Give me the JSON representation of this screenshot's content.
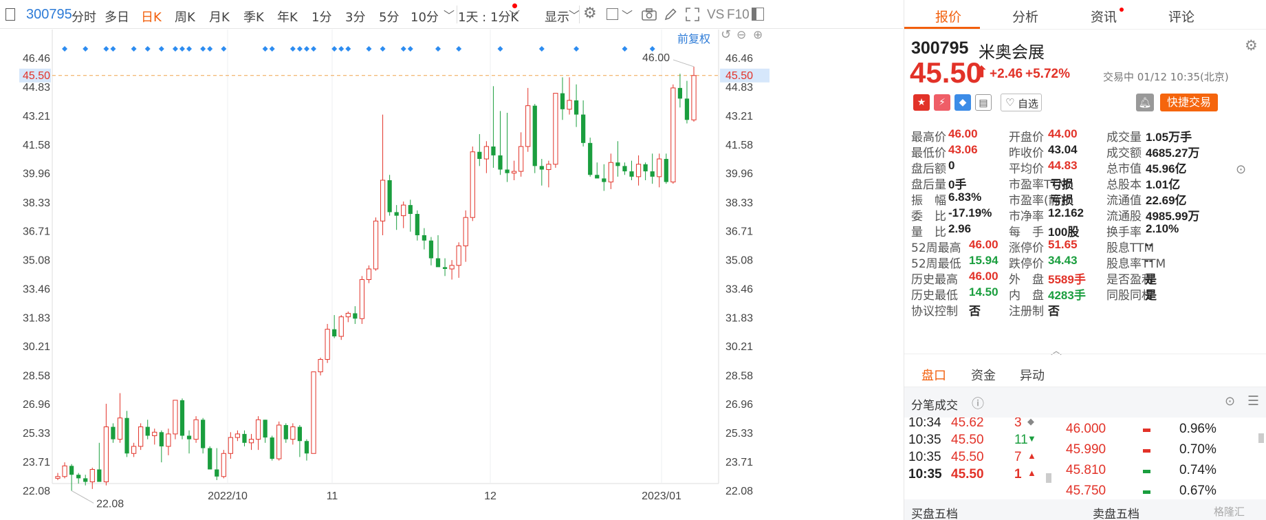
{
  "toolbar": {
    "code": "300795",
    "tabs": [
      "分时",
      "多日",
      "日K",
      "周K",
      "月K",
      "季K",
      "年K",
      "1分",
      "3分",
      "5分",
      "10分"
    ],
    "active_tab": "日K",
    "interval_label": "1天 : 1分K",
    "display_label": "显示",
    "vs_label": "VS",
    "f10_label": "F10",
    "fq_label": "前复权"
  },
  "chart_data": {
    "type": "candlestick",
    "x_ticks": [
      "2022/10",
      "11",
      "12",
      "2023/01"
    ],
    "y_ticks": [
      46.46,
      44.83,
      43.21,
      41.58,
      39.96,
      38.33,
      36.71,
      35.08,
      33.46,
      31.83,
      30.21,
      28.58,
      26.96,
      25.33,
      23.71,
      22.08
    ],
    "ylim": [
      20.45,
      48.09
    ],
    "price_line": 45.5,
    "max_label": "46.00",
    "min_label": "22.08",
    "candles": [
      [
        22.8,
        23.1,
        22.7,
        22.9
      ],
      [
        22.9,
        23.7,
        22.8,
        23.5
      ],
      [
        23.5,
        23.6,
        22.1,
        23.0
      ],
      [
        23.0,
        23.1,
        22.5,
        22.8
      ],
      [
        22.8,
        23.0,
        22.4,
        22.6
      ],
      [
        22.6,
        23.4,
        22.2,
        23.3
      ],
      [
        23.3,
        24.8,
        23.0,
        22.6
      ],
      [
        22.6,
        27.0,
        22.4,
        25.7
      ],
      [
        25.7,
        25.9,
        24.8,
        25.0
      ],
      [
        25.0,
        27.6,
        24.8,
        26.2
      ],
      [
        26.2,
        26.6,
        24.0,
        24.2
      ],
      [
        24.2,
        24.8,
        24.0,
        24.6
      ],
      [
        24.6,
        25.9,
        24.4,
        25.7
      ],
      [
        25.7,
        26.1,
        25.0,
        25.2
      ],
      [
        25.2,
        25.6,
        24.7,
        25.4
      ],
      [
        25.4,
        25.5,
        23.7,
        24.6
      ],
      [
        24.6,
        25.6,
        24.1,
        25.3
      ],
      [
        25.3,
        27.2,
        25.0,
        27.2
      ],
      [
        27.2,
        27.3,
        25.0,
        25.2
      ],
      [
        25.2,
        25.5,
        24.2,
        25.0
      ],
      [
        25.0,
        26.3,
        24.8,
        26.1
      ],
      [
        26.1,
        26.2,
        24.2,
        24.5
      ],
      [
        24.5,
        24.6,
        23.3,
        23.3
      ],
      [
        23.3,
        24.5,
        22.7,
        22.9
      ],
      [
        22.9,
        24.4,
        22.8,
        24.2
      ],
      [
        24.2,
        25.4,
        23.9,
        25.1
      ],
      [
        25.1,
        25.5,
        24.9,
        25.3
      ],
      [
        25.3,
        25.5,
        24.6,
        24.8
      ],
      [
        24.8,
        25.3,
        24.4,
        25.0
      ],
      [
        25.0,
        26.3,
        24.4,
        26.1
      ],
      [
        26.1,
        26.1,
        24.8,
        25.1
      ],
      [
        25.1,
        25.2,
        23.8,
        23.9
      ],
      [
        23.9,
        26.0,
        23.8,
        25.8
      ],
      [
        25.8,
        25.9,
        24.8,
        25.0
      ],
      [
        25.0,
        25.9,
        24.7,
        25.7
      ],
      [
        25.7,
        25.8,
        24.0,
        24.9
      ],
      [
        24.9,
        25.0,
        23.8,
        24.2
      ],
      [
        24.2,
        28.8,
        24.2,
        28.8
      ],
      [
        28.8,
        29.6,
        28.6,
        29.5
      ],
      [
        29.5,
        31.5,
        29.3,
        31.2
      ],
      [
        31.2,
        32.0,
        30.7,
        30.8
      ],
      [
        30.8,
        32.0,
        30.6,
        31.9
      ],
      [
        31.9,
        32.2,
        31.6,
        32.1
      ],
      [
        32.1,
        32.5,
        31.5,
        31.8
      ],
      [
        31.8,
        34.2,
        31.5,
        34.0
      ],
      [
        34.0,
        34.8,
        33.8,
        34.6
      ],
      [
        34.6,
        37.5,
        34.5,
        37.3
      ],
      [
        37.3,
        43.3,
        36.5,
        39.6
      ],
      [
        39.6,
        39.9,
        37.6,
        37.8
      ],
      [
        37.8,
        38.2,
        36.8,
        37.6
      ],
      [
        37.6,
        38.4,
        36.9,
        38.2
      ],
      [
        38.2,
        38.5,
        36.7,
        37.7
      ],
      [
        37.7,
        37.9,
        36.2,
        36.5
      ],
      [
        36.5,
        36.9,
        35.7,
        36.2
      ],
      [
        36.2,
        36.4,
        34.8,
        35.2
      ],
      [
        35.2,
        36.5,
        35.0,
        34.7
      ],
      [
        34.7,
        35.2,
        34.2,
        34.6
      ],
      [
        34.6,
        35.1,
        34.0,
        34.8
      ],
      [
        34.8,
        36.1,
        34.1,
        35.9
      ],
      [
        35.9,
        37.9,
        35.0,
        37.5
      ],
      [
        37.5,
        41.5,
        37.3,
        41.2
      ],
      [
        41.2,
        42.2,
        40.4,
        40.8
      ],
      [
        40.8,
        41.8,
        40.0,
        41.5
      ],
      [
        41.5,
        44.9,
        40.3,
        41.0
      ],
      [
        41.0,
        43.5,
        39.9,
        40.2
      ],
      [
        40.2,
        43.4,
        39.5,
        40.0
      ],
      [
        40.0,
        40.7,
        39.6,
        40.1
      ],
      [
        40.1,
        42.3,
        39.8,
        41.5
      ],
      [
        41.5,
        44.8,
        41.2,
        43.8
      ],
      [
        43.8,
        43.9,
        40.0,
        40.4
      ],
      [
        40.4,
        40.8,
        39.3,
        40.2
      ],
      [
        40.2,
        40.7,
        39.2,
        40.5
      ],
      [
        40.5,
        44.5,
        40.3,
        44.5
      ],
      [
        44.5,
        45.4,
        43.0,
        43.6
      ],
      [
        43.6,
        45.4,
        43.3,
        44.1
      ],
      [
        44.1,
        45.0,
        42.6,
        43.3
      ],
      [
        43.3,
        44.1,
        41.5,
        41.7
      ],
      [
        41.7,
        42.0,
        39.8,
        39.9
      ],
      [
        39.9,
        40.6,
        39.8,
        39.7
      ],
      [
        39.7,
        40.5,
        39.0,
        39.5
      ],
      [
        39.5,
        41.1,
        39.1,
        40.6
      ],
      [
        40.6,
        41.8,
        39.8,
        40.4
      ],
      [
        40.4,
        40.6,
        39.9,
        40.1
      ],
      [
        40.1,
        40.7,
        39.6,
        39.8
      ],
      [
        39.8,
        41.0,
        39.3,
        40.5
      ],
      [
        40.5,
        40.6,
        39.6,
        40.1
      ],
      [
        40.1,
        41.1,
        39.4,
        39.8
      ],
      [
        39.8,
        41.1,
        39.2,
        40.8
      ],
      [
        40.8,
        41.1,
        39.4,
        39.5
      ],
      [
        39.5,
        45.0,
        39.4,
        44.8
      ],
      [
        44.8,
        45.6,
        43.7,
        44.2
      ],
      [
        44.2,
        45.2,
        42.8,
        43.0
      ],
      [
        43.0,
        46.0,
        42.9,
        45.5
      ]
    ]
  },
  "panel": {
    "tabs": [
      "报价",
      "分析",
      "资讯",
      "评论"
    ],
    "code": "300795",
    "name": "米奥会展",
    "price": "45.50",
    "arrow": "⬆",
    "change": "+2.46",
    "change_pct": "+5.72%",
    "status": "交易中 01/12 10:35(北京)",
    "watch_label": "自选",
    "trade_label": "快捷交易",
    "stats": [
      [
        {
          "label": "最高价",
          "value": "46.00",
          "tone": "up"
        },
        {
          "label": "最低价",
          "value": "43.06",
          "tone": "up"
        },
        {
          "label": "盘后额",
          "value": "0",
          "tone": "neutral"
        },
        {
          "label": "盘后量",
          "value": "0手",
          "tone": "neutral"
        },
        {
          "label": "振　幅",
          "value": "6.83%",
          "tone": "neutral"
        },
        {
          "label": "委　比",
          "value": "-17.19%",
          "tone": "neutral"
        },
        {
          "label": "量　比",
          "value": "2.96",
          "tone": "neutral"
        },
        {
          "label": "52周最高",
          "value": "46.00",
          "tone": "up"
        },
        {
          "label": "52周最低",
          "value": "15.94",
          "tone": "down"
        },
        {
          "label": "历史最高",
          "value": "46.00",
          "tone": "up"
        },
        {
          "label": "历史最低",
          "value": "14.50",
          "tone": "down"
        },
        {
          "label": "协议控制",
          "value": "否",
          "tone": "neutral"
        }
      ],
      [
        {
          "label": "开盘价",
          "value": "44.00",
          "tone": "up"
        },
        {
          "label": "昨收价",
          "value": "43.04",
          "tone": "neutral"
        },
        {
          "label": "平均价",
          "value": "44.83",
          "tone": "up"
        },
        {
          "label": "市盈率TTM",
          "value": "亏损",
          "tone": "neutral"
        },
        {
          "label": "市盈率(静)",
          "value": "亏损",
          "tone": "neutral"
        },
        {
          "label": "市净率",
          "value": "12.162",
          "tone": "neutral"
        },
        {
          "label": "每　手",
          "value": "100股",
          "tone": "neutral"
        },
        {
          "label": "涨停价",
          "value": "51.65",
          "tone": "up"
        },
        {
          "label": "跌停价",
          "value": "34.43",
          "tone": "down"
        },
        {
          "label": "外　盘",
          "value": "5589手",
          "tone": "up"
        },
        {
          "label": "内　盘",
          "value": "4283手",
          "tone": "down"
        },
        {
          "label": "注册制",
          "value": "否",
          "tone": "neutral"
        }
      ],
      [
        {
          "label": "成交量",
          "value": "1.05万手",
          "tone": "neutral"
        },
        {
          "label": "成交额",
          "value": "4685.27万",
          "tone": "neutral"
        },
        {
          "label": "总市值",
          "value": "45.96亿",
          "tone": "neutral"
        },
        {
          "label": "总股本",
          "value": "1.01亿",
          "tone": "neutral"
        },
        {
          "label": "流通值",
          "value": "22.69亿",
          "tone": "neutral"
        },
        {
          "label": "流通股",
          "value": "4985.99万",
          "tone": "neutral"
        },
        {
          "label": "换手率",
          "value": "2.10%",
          "tone": "neutral"
        },
        {
          "label": "股息TTM",
          "value": "--",
          "tone": "neutral"
        },
        {
          "label": "股息率TTM",
          "value": "--",
          "tone": "neutral"
        },
        {
          "label": "是否盈利",
          "value": "是",
          "tone": "neutral"
        },
        {
          "label": "同股同权",
          "value": "是",
          "tone": "neutral"
        }
      ]
    ],
    "sub_tabs": [
      "盘口",
      "资金",
      "异动"
    ],
    "ticks_title": "分笔成交",
    "ticks": [
      {
        "time": "10:34",
        "price": "45.62",
        "vol": "3",
        "dir": "flat"
      },
      {
        "time": "10:35",
        "price": "45.50",
        "vol": "11",
        "dir": "down"
      },
      {
        "time": "10:35",
        "price": "45.50",
        "vol": "7",
        "dir": "up"
      },
      {
        "time": "10:35",
        "price": "45.50",
        "vol": "1",
        "dir": "up"
      }
    ],
    "book": [
      {
        "price": "46.000",
        "pct": "0.96%",
        "dir": "up"
      },
      {
        "price": "45.990",
        "pct": "0.70%",
        "dir": "up"
      },
      {
        "price": "45.810",
        "pct": "0.74%",
        "dir": "down"
      },
      {
        "price": "45.750",
        "pct": "0.67%",
        "dir": "down"
      }
    ],
    "buy5": "买盘五档",
    "sell5": "卖盘五档",
    "watermark": "格隆汇"
  }
}
